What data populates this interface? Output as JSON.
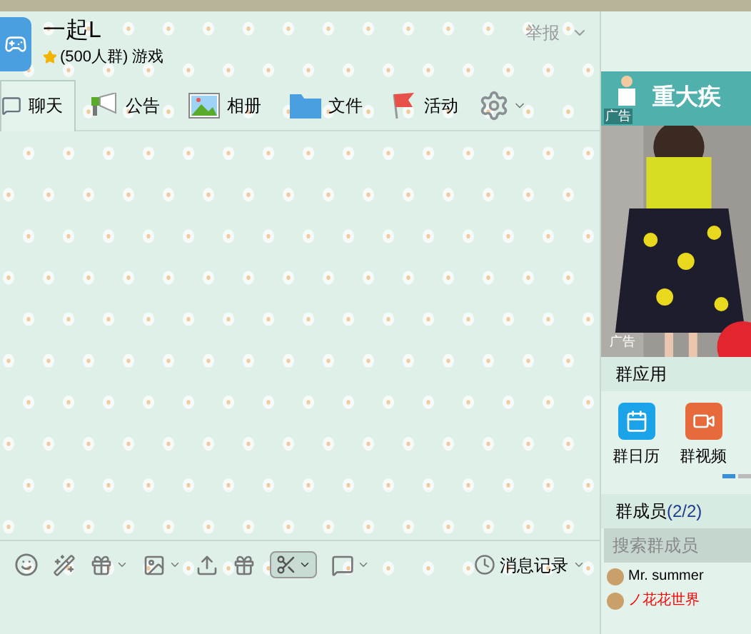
{
  "group": {
    "name": "一起L",
    "info": "(500人群) 游戏",
    "report": "举报"
  },
  "tabs": [
    {
      "label": "聊天",
      "kind": "chat",
      "selected": true
    },
    {
      "label": "公告",
      "kind": "notice",
      "selected": false
    },
    {
      "label": "相册",
      "kind": "album",
      "selected": false
    },
    {
      "label": "文件",
      "kind": "folder",
      "selected": false
    },
    {
      "label": "活动",
      "kind": "flag",
      "selected": false
    }
  ],
  "ads": {
    "banner": "重大疾",
    "banner_tag": "广告",
    "image_tag": "广告"
  },
  "apps": {
    "title": "群应用",
    "items": [
      {
        "label": "群日历",
        "kind": "calendar"
      },
      {
        "label": "群视频",
        "kind": "video"
      }
    ]
  },
  "members": {
    "title": "群成员",
    "count": "(2/2)",
    "search_placeholder": "搜索群成员",
    "list": [
      {
        "name": "Mr. summer",
        "color": "#000000"
      },
      {
        "name": "ノ花花世界",
        "color": "#ff0000"
      }
    ]
  },
  "input_toolbar": {
    "history": "消息记录"
  }
}
